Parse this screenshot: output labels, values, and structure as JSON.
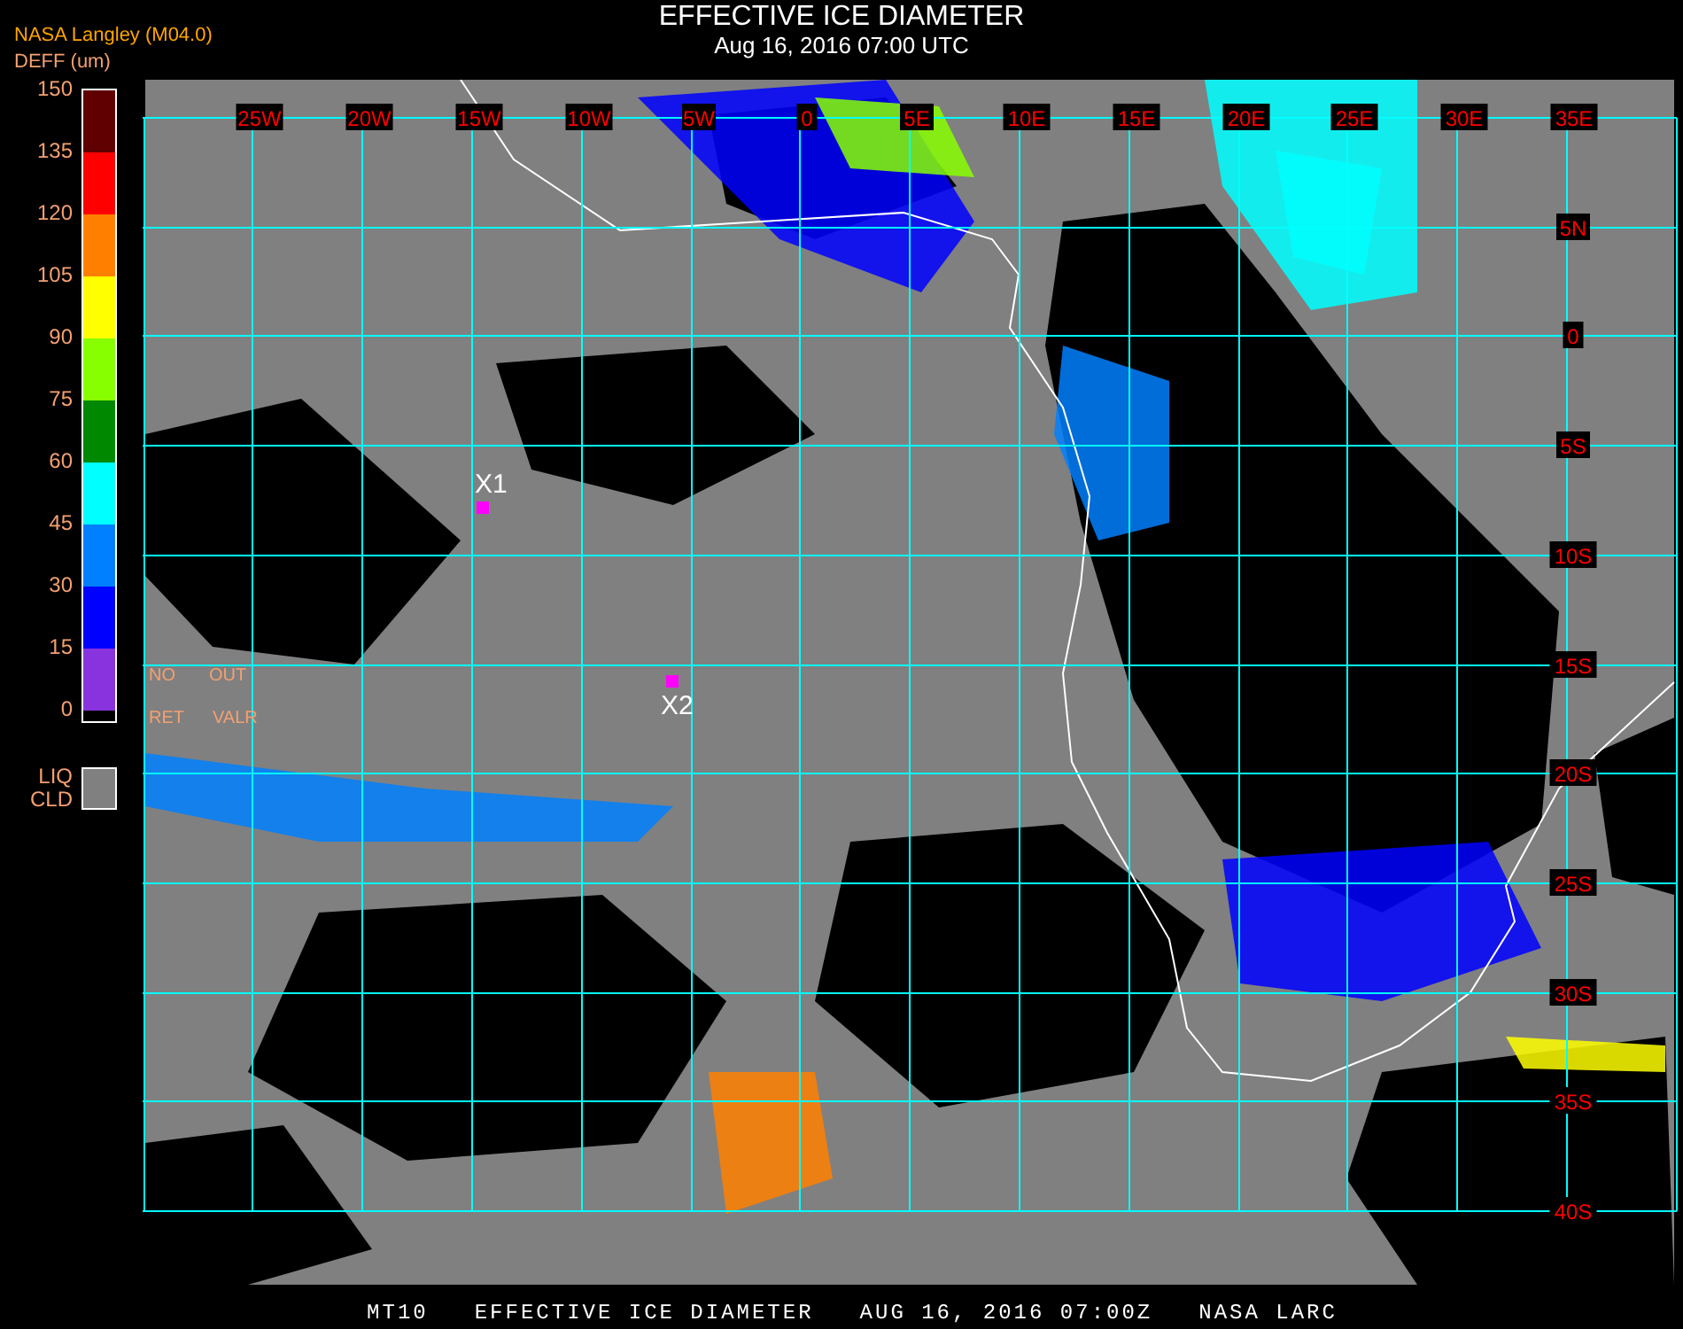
{
  "header": {
    "title": "EFFECTIVE ICE DIAMETER",
    "subtitle": "Aug 16, 2016 07:00 UTC"
  },
  "legend": {
    "source": "NASA Langley (M04.0)",
    "unit_label": "DEFF (um)",
    "ticks": [
      "150",
      "135",
      "120",
      "105",
      "90",
      "75",
      "60",
      "45",
      "30",
      "15",
      "0"
    ],
    "bands": [
      {
        "color": "#600000"
      },
      {
        "color": "#ff0000"
      },
      {
        "color": "#ff8000"
      },
      {
        "color": "#ffff00"
      },
      {
        "color": "#88ff00"
      },
      {
        "color": "#008800"
      },
      {
        "color": "#00ffff"
      },
      {
        "color": "#0080ff"
      },
      {
        "color": "#0000ff"
      },
      {
        "color": "#8833dd"
      }
    ],
    "no_retrieval": [
      [
        "NO",
        "OUT"
      ],
      [
        "RET",
        "VALR"
      ]
    ],
    "liquid_cloud": {
      "lines": [
        "LIQ",
        "CLD"
      ],
      "color": "#808080"
    }
  },
  "map": {
    "lon_labels": [
      "25W",
      "20W",
      "15W",
      "10W",
      "5W",
      "0",
      "5E",
      "10E",
      "15E",
      "20E",
      "25E",
      "30E",
      "35E"
    ],
    "lat_labels": [
      "5N",
      "0",
      "5S",
      "10S",
      "15S",
      "20S",
      "25S",
      "30S",
      "35S",
      "40S"
    ],
    "markers": [
      {
        "label": "X1"
      },
      {
        "label": "X2"
      }
    ]
  },
  "footer": {
    "parts": [
      "MT10",
      "EFFECTIVE ICE DIAMETER",
      "AUG 16, 2016 07:00Z",
      "NASA LARC"
    ]
  }
}
